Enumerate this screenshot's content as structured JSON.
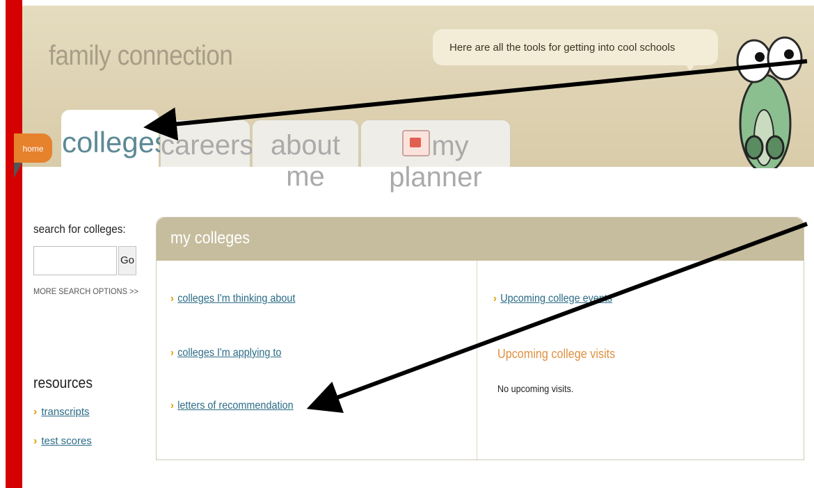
{
  "header": {
    "site_title": "family connection",
    "bubble_text": "Here are all the tools for getting into cool schools"
  },
  "nav": {
    "home_label": "home",
    "tabs": [
      {
        "label": "colleges",
        "active": true
      },
      {
        "label": "careers",
        "active": false
      },
      {
        "label": "about me",
        "active": false
      },
      {
        "label": "my planner",
        "active": false,
        "icon": "planner-icon"
      }
    ]
  },
  "sidebar": {
    "search_label": "search for colleges:",
    "search_value": "",
    "go_label": "Go",
    "more_search_label": "MORE SEARCH OPTIONS >>",
    "resources_heading": "resources",
    "resource_links": [
      "transcripts",
      "test scores"
    ]
  },
  "panel": {
    "title": "my colleges",
    "left_links": [
      "colleges I'm thinking about",
      "colleges I'm applying to",
      "letters of recommendation"
    ],
    "right_link": "Upcoming college events",
    "visits_title": "Upcoming college visits",
    "visits_text": "No upcoming visits."
  },
  "colors": {
    "accent_red": "#d50000",
    "header_beige": "#ddd1b1",
    "home_orange": "#e6812c",
    "link_blue": "#2a6b86",
    "chevron_gold": "#e0a000"
  }
}
